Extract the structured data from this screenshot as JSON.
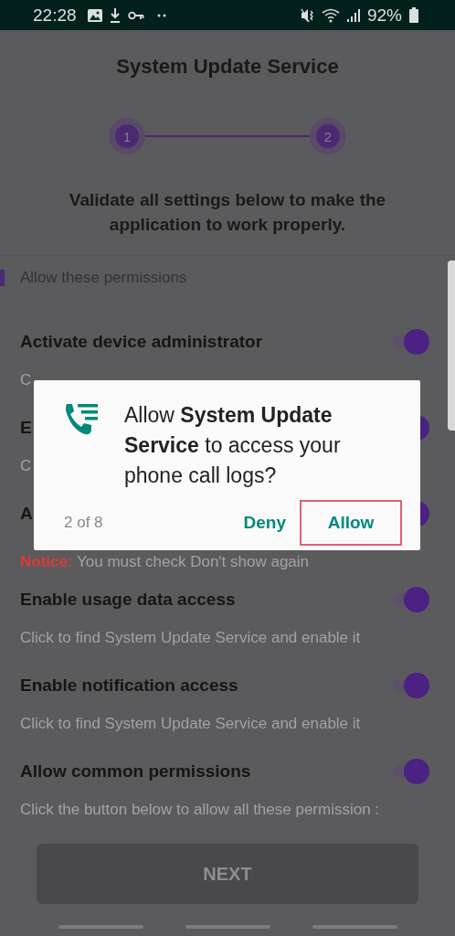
{
  "status_bar": {
    "time": "22:28",
    "battery": "92%"
  },
  "header": {
    "title": "System Update Service"
  },
  "stepper": {
    "steps": [
      "1",
      "2"
    ]
  },
  "instruction": "Validate all settings below to make the application to work properly.",
  "section": {
    "title": "Allow these permissions"
  },
  "permissions": [
    {
      "kind": "plain",
      "title": "Activate device administrator",
      "description": "C",
      "on": true
    },
    {
      "kind": "plain",
      "title": "E",
      "description": "C",
      "on": true
    },
    {
      "kind": "notice",
      "title": "A",
      "notice_label": "Notice:",
      "description": "You must check Don't show again",
      "on": true
    },
    {
      "kind": "plain",
      "title": "Enable usage data access",
      "description": "Click to find System Update Service and enable it",
      "on": true
    },
    {
      "kind": "plain",
      "title": "Enable notification access",
      "description": "Click to find System Update Service and enable it",
      "on": true
    },
    {
      "kind": "plain",
      "title": "Allow common permissions",
      "description": "Click the button below to allow all these permission :",
      "on": true
    }
  ],
  "next_button": {
    "label": "NEXT",
    "disabled": true
  },
  "dialog": {
    "message": "Allow **System Update Service** to access your phone call logs?",
    "counter": "2 of 8",
    "buttons": [
      {
        "label": "Deny",
        "highlighted": false
      },
      {
        "label": "Allow",
        "highlighted": true
      }
    ]
  }
}
